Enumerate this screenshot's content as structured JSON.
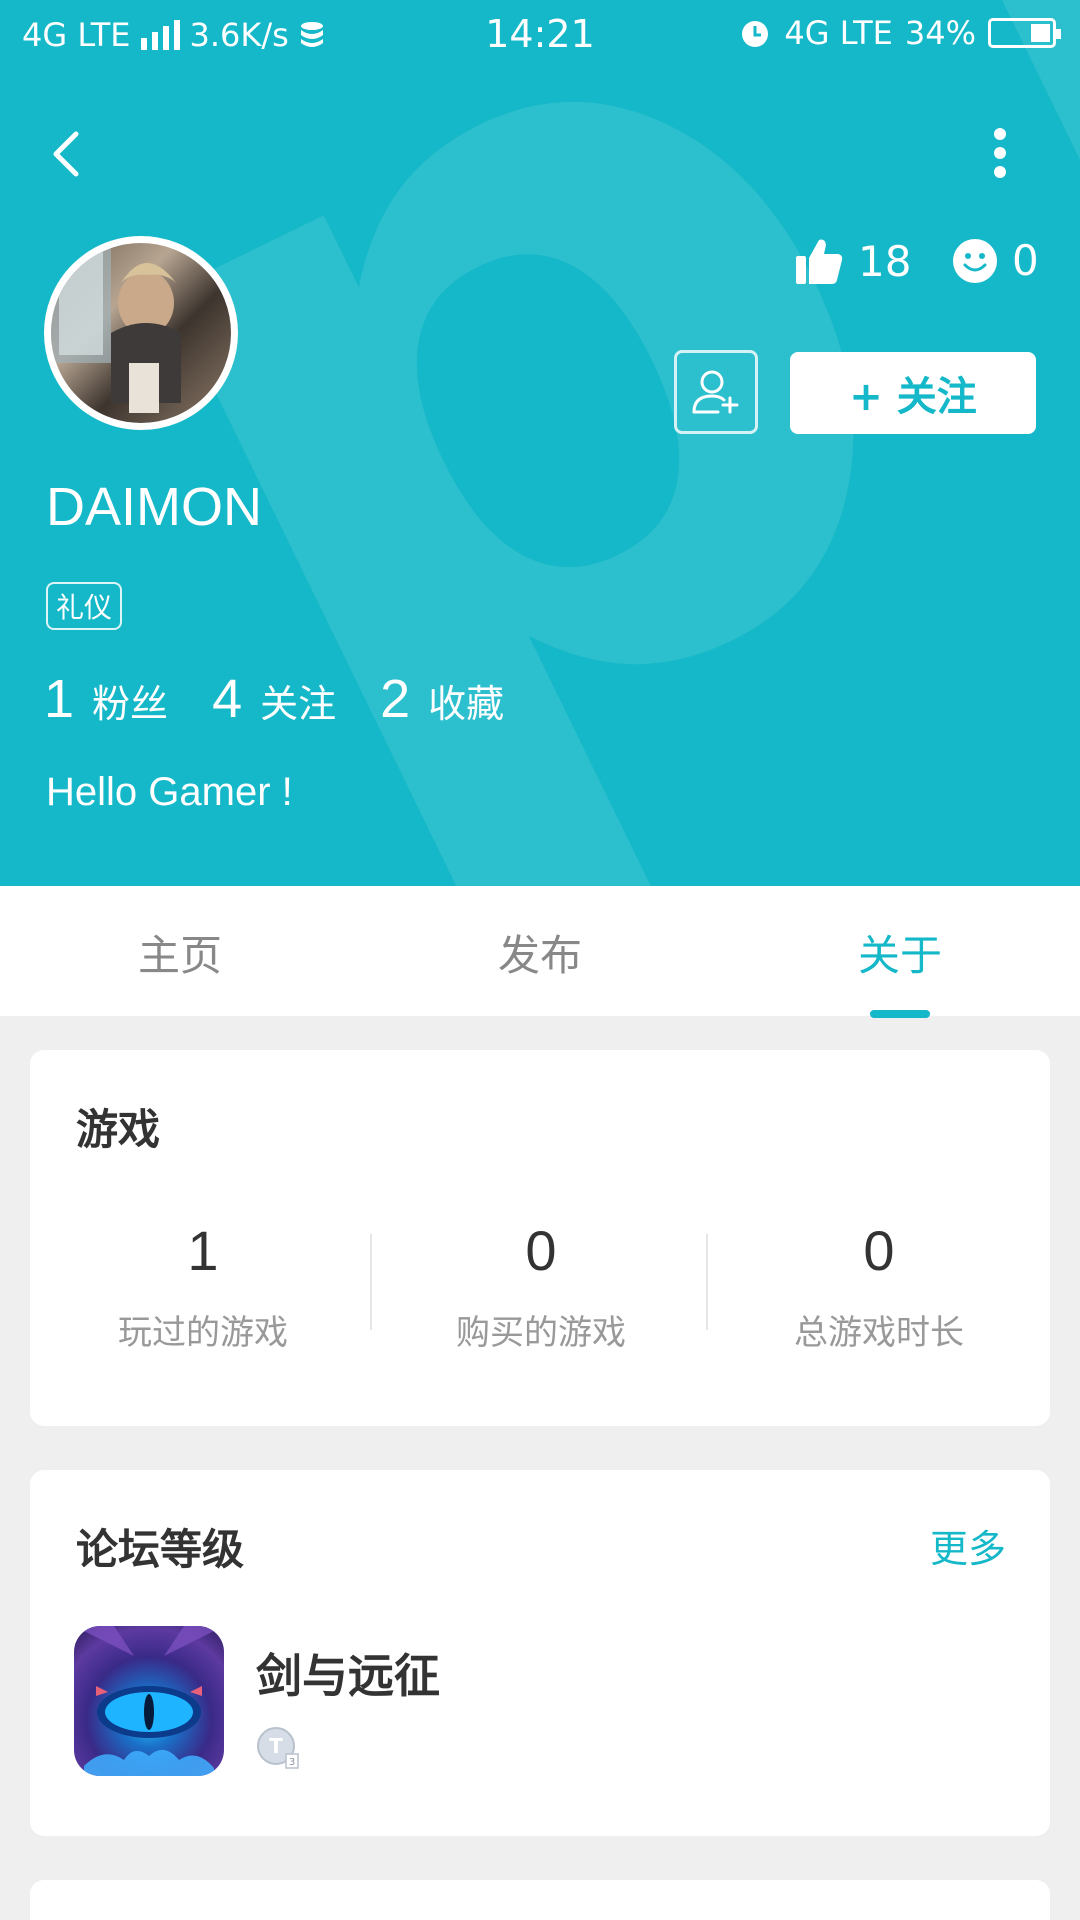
{
  "status_bar": {
    "network_left": "4G LTE",
    "speed": "3.6K/s",
    "time": "14:21",
    "network_right": "4G LTE",
    "battery": "34%",
    "battery_level": 0.34
  },
  "header": {
    "background_color": "#15b8c8",
    "likes_count": "18",
    "smiles_count": "0",
    "follow_button": "+ 关注",
    "username": "DAIMON",
    "badge": "礼仪",
    "stats": [
      {
        "num": "1",
        "label": "粉丝"
      },
      {
        "num": "4",
        "label": "关注"
      },
      {
        "num": "2",
        "label": "收藏"
      }
    ],
    "bio": "Hello Gamer !"
  },
  "tabs": [
    {
      "label": "主页"
    },
    {
      "label": "发布"
    },
    {
      "label": "关于",
      "active": true
    }
  ],
  "games_card": {
    "title": "游戏",
    "stats": [
      {
        "num": "1",
        "label": "玩过的游戏"
      },
      {
        "num": "0",
        "label": "购买的游戏"
      },
      {
        "num": "0",
        "label": "总游戏时长"
      }
    ]
  },
  "forum_card": {
    "title": "论坛等级",
    "more": "更多",
    "game_name": "剑与远征"
  }
}
